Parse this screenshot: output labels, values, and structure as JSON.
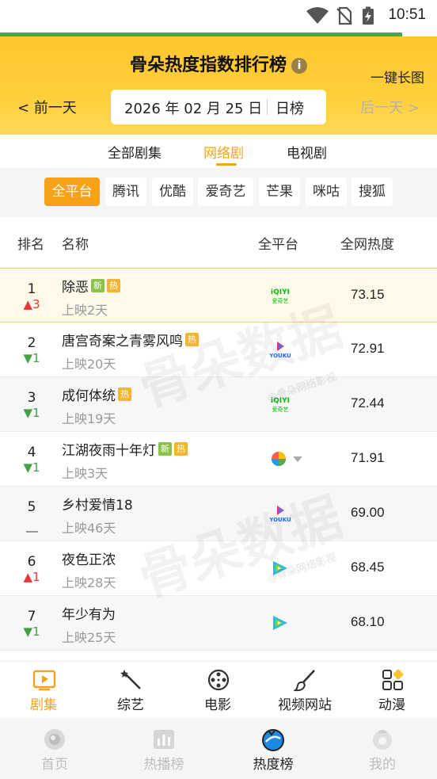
{
  "status_bar": {
    "time": "10:51",
    "icons": [
      "wifi-icon",
      "no-sim-icon",
      "battery-charging-icon"
    ]
  },
  "header": {
    "title": "骨朵热度指数排行榜",
    "info_icon": "i",
    "long_image_label": "一键长图",
    "prev_label": "< 前一天",
    "next_label": "后一天 >",
    "date": "2026 年 02 月 25 日",
    "mode": "日榜"
  },
  "category_tabs": [
    {
      "label": "全部剧集",
      "active": false
    },
    {
      "label": "网络剧",
      "active": true
    },
    {
      "label": "电视剧",
      "active": false
    }
  ],
  "platform_chips": [
    {
      "label": "全平台",
      "active": true
    },
    {
      "label": "腾讯",
      "active": false
    },
    {
      "label": "优酷",
      "active": false
    },
    {
      "label": "爱奇艺",
      "active": false
    },
    {
      "label": "芒果",
      "active": false
    },
    {
      "label": "咪咕",
      "active": false
    },
    {
      "label": "搜狐",
      "active": false
    }
  ],
  "table_header": {
    "rank": "排名",
    "name": "名称",
    "platform": "全平台",
    "heat": "全网热度"
  },
  "rows": [
    {
      "rank": "1",
      "change": "3",
      "trend": "up",
      "name": "除恶",
      "badges": [
        "新",
        "热"
      ],
      "days": "上映2天",
      "platform": "iqiyi",
      "heat": "73.15"
    },
    {
      "rank": "2",
      "change": "1",
      "trend": "down",
      "name": "唐宫奇案之青雾风鸣",
      "badges": [
        "热"
      ],
      "days": "上映20天",
      "platform": "youku",
      "heat": "72.91"
    },
    {
      "rank": "3",
      "change": "1",
      "trend": "down",
      "name": "成何体统",
      "badges": [
        "热"
      ],
      "days": "上映19天",
      "platform": "iqiyi",
      "heat": "72.44"
    },
    {
      "rank": "4",
      "change": "1",
      "trend": "down",
      "name": "江湖夜雨十年灯",
      "badges": [
        "新",
        "热"
      ],
      "days": "上映3天",
      "platform": "multi",
      "heat": "71.91"
    },
    {
      "rank": "5",
      "change": "",
      "trend": "flat",
      "name": "乡村爱情18",
      "badges": [],
      "days": "上映46天",
      "platform": "youku",
      "heat": "69.00"
    },
    {
      "rank": "6",
      "change": "1",
      "trend": "up",
      "name": "夜色正浓",
      "badges": [],
      "days": "上映28天",
      "platform": "tencent",
      "heat": "68.45"
    },
    {
      "rank": "7",
      "change": "1",
      "trend": "down",
      "name": "年少有为",
      "badges": [],
      "days": "上映25天",
      "platform": "tencent",
      "heat": "68.10"
    }
  ],
  "platform_logo_text": {
    "iqiyi_top": "iQIYI",
    "iqiyi_bottom": "爱奇艺",
    "youku": "YOUKU"
  },
  "watermark": {
    "big": "骨朵数据",
    "small": "@骨朵网络影视"
  },
  "category_bar": [
    {
      "label": "剧集",
      "icon": "tv-icon",
      "active": true
    },
    {
      "label": "综艺",
      "icon": "magic-wand-icon",
      "active": false
    },
    {
      "label": "电影",
      "icon": "film-reel-icon",
      "active": false
    },
    {
      "label": "视频网站",
      "icon": "brush-icon",
      "active": false
    },
    {
      "label": "动漫",
      "icon": "grid-icon",
      "active": false
    }
  ],
  "bottom_nav": [
    {
      "label": "首页",
      "icon": "home-icon",
      "active": false
    },
    {
      "label": "热播榜",
      "icon": "chart-icon",
      "active": false
    },
    {
      "label": "热度榜",
      "icon": "heat-icon",
      "active": true
    },
    {
      "label": "我的",
      "icon": "profile-icon",
      "active": false
    }
  ],
  "colors": {
    "accent": "#f7a21a",
    "header_yellow": "#ffc52e",
    "up": "#e53935",
    "down": "#43a047",
    "new_badge": "#8bc34a",
    "hot_badge": "#f5b335"
  }
}
